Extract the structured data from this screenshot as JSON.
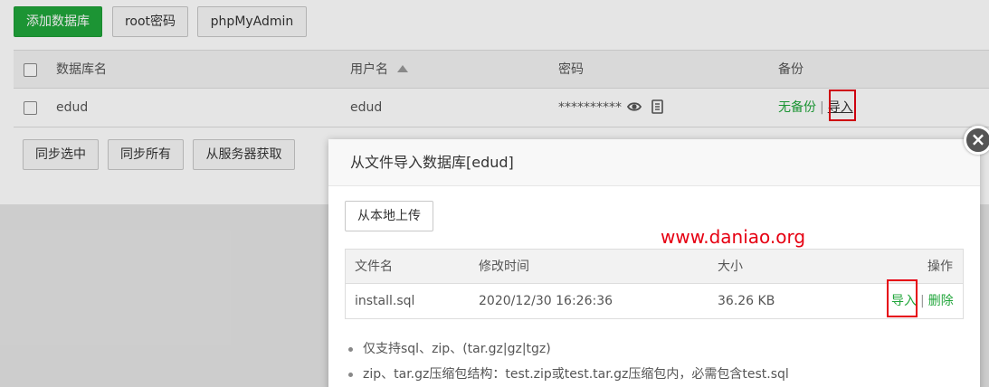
{
  "toolbar": {
    "add_db": "添加数据库",
    "root_password": "root密码",
    "phpmyadmin": "phpMyAdmin"
  },
  "db_table": {
    "headers": {
      "name": "数据库名",
      "user": "用户名",
      "password": "密码",
      "backup": "备份"
    },
    "row": {
      "name": "edud",
      "user": "edud",
      "password": "**********",
      "backup_status": "无备份",
      "separator": "|",
      "import": "导入"
    }
  },
  "sync": {
    "selected": "同步选中",
    "all": "同步所有",
    "from_server": "从服务器获取"
  },
  "dialog": {
    "title": "从文件导入数据库[edud]",
    "close": "×",
    "upload_local": "从本地上传",
    "watermark": "www.daniao.org",
    "file_table": {
      "headers": {
        "filename": "文件名",
        "mtime": "修改时间",
        "size": "大小",
        "ops": "操作"
      },
      "rows": [
        {
          "filename": "install.sql",
          "mtime": "2020/12/30 16:26:36",
          "size": "36.26 KB",
          "import": "导入",
          "separator": "|",
          "delete": "删除"
        }
      ]
    },
    "notes": [
      "仅支持sql、zip、(tar.gz|gz|tgz)",
      "zip、tar.gz压缩包结构：test.zip或test.tar.gz压缩包内，必需包含test.sql"
    ]
  },
  "colors": {
    "accent": "#20a53a",
    "highlight": "#e60012"
  },
  "icons": {
    "show_password": "eye-icon",
    "copy_password": "copy-icon",
    "close": "close-icon"
  }
}
